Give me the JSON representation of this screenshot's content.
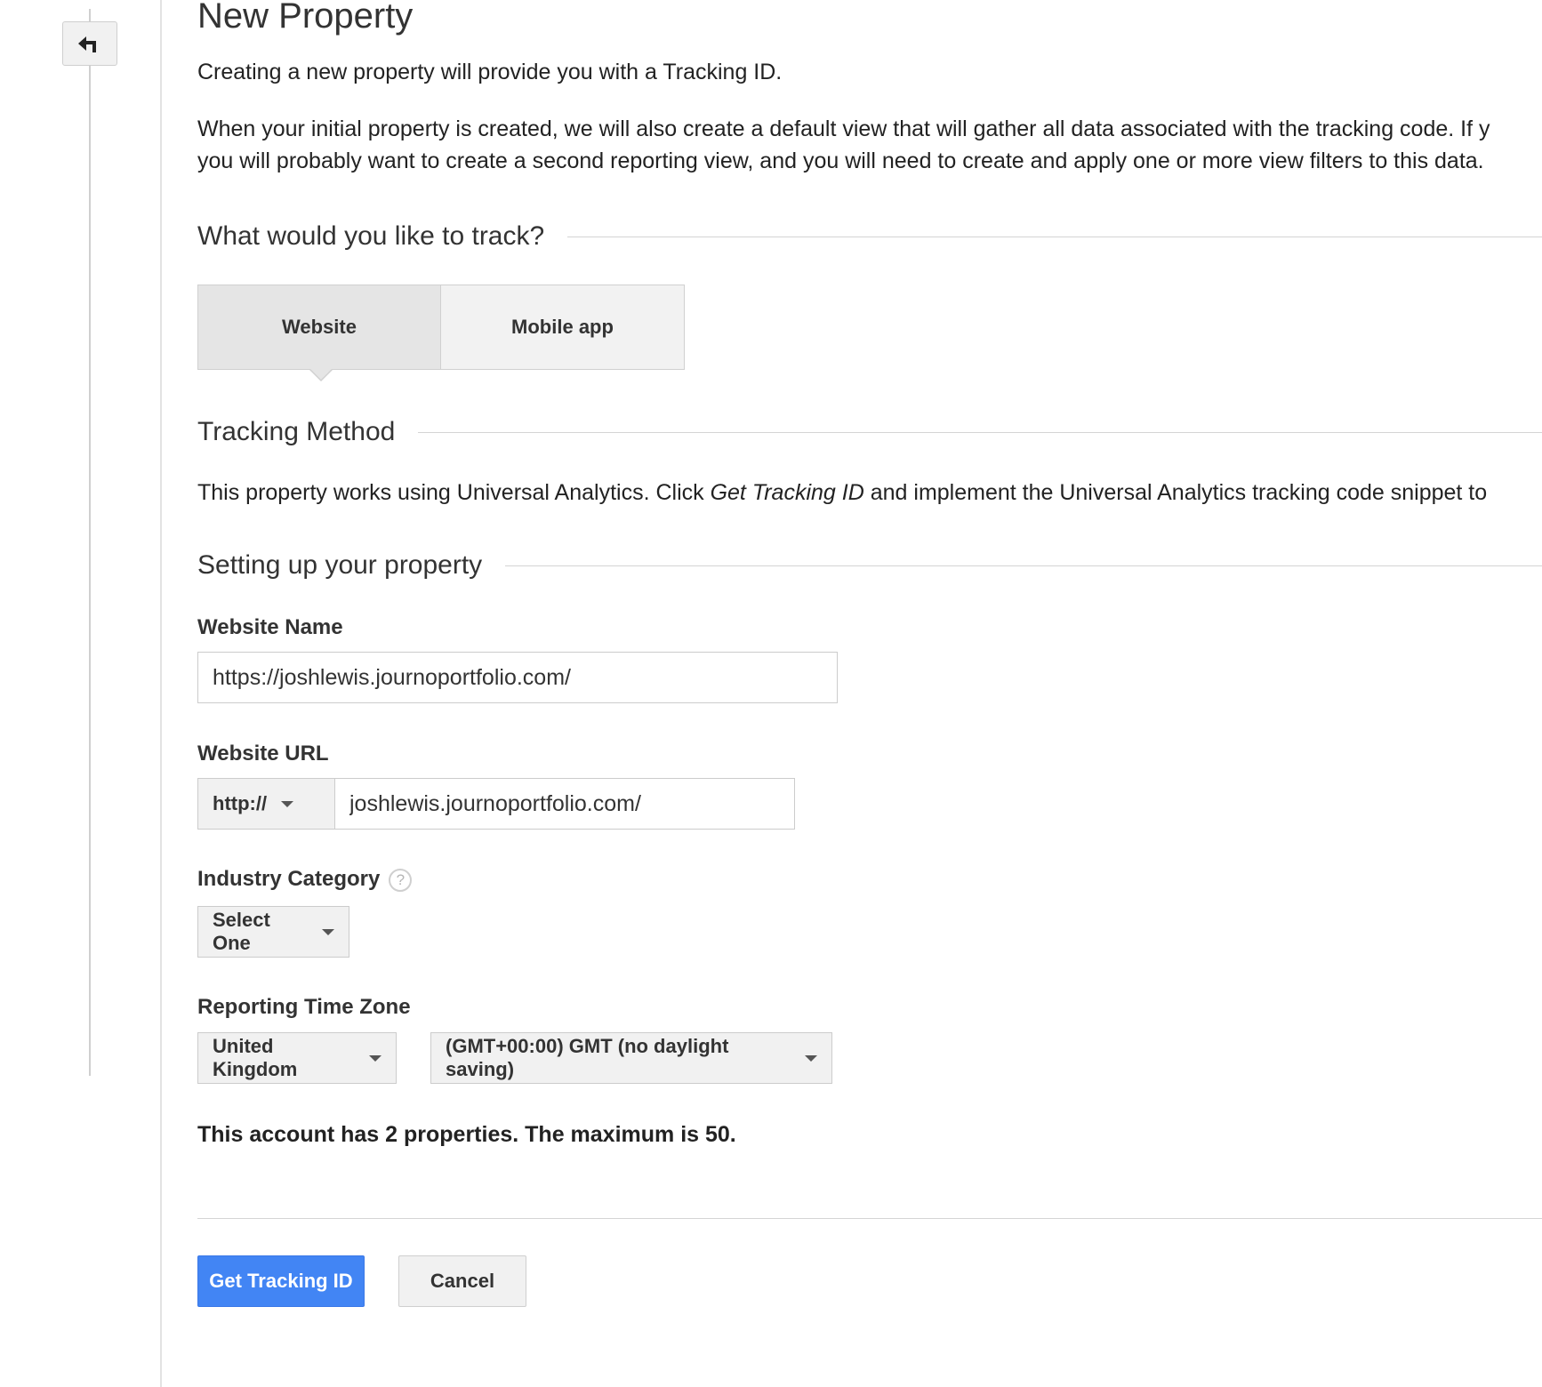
{
  "page": {
    "title": "New Property",
    "intro": "Creating a new property will provide you with a Tracking ID.",
    "intro_detail_line1": "When your initial property is created, we will also create a default view that will gather all data associated with the tracking code. If y",
    "intro_detail_line2": "you will probably want to create a second reporting view, and you will need to create and apply one or more view filters to this data."
  },
  "track": {
    "heading": "What would you like to track?",
    "options": [
      {
        "label": "Website",
        "selected": true
      },
      {
        "label": "Mobile app",
        "selected": false
      }
    ]
  },
  "method": {
    "heading": "Tracking Method",
    "text_before": "This property works using Universal Analytics. Click ",
    "text_emphasis": "Get Tracking ID",
    "text_after": " and implement the Universal Analytics tracking code snippet to"
  },
  "setup": {
    "heading": "Setting up your property",
    "website_name_label": "Website Name",
    "website_name_value": "https://joshlewis.journoportfolio.com/",
    "website_url_label": "Website URL",
    "protocol_value": "http://",
    "website_url_value": "joshlewis.journoportfolio.com/",
    "industry_label": "Industry Category",
    "industry_value": "Select One",
    "timezone_label": "Reporting Time Zone",
    "timezone_country": "United Kingdom",
    "timezone_value": "(GMT+00:00) GMT (no daylight saving)"
  },
  "limit_text": "This account has 2 properties. The maximum is 50.",
  "actions": {
    "primary": "Get Tracking ID",
    "cancel": "Cancel"
  },
  "icons": {
    "back": "back-arrow-icon",
    "help": "help-icon",
    "dropdown": "caret-down-icon"
  },
  "colors": {
    "primary_button": "#4285f4",
    "text": "#222222"
  }
}
